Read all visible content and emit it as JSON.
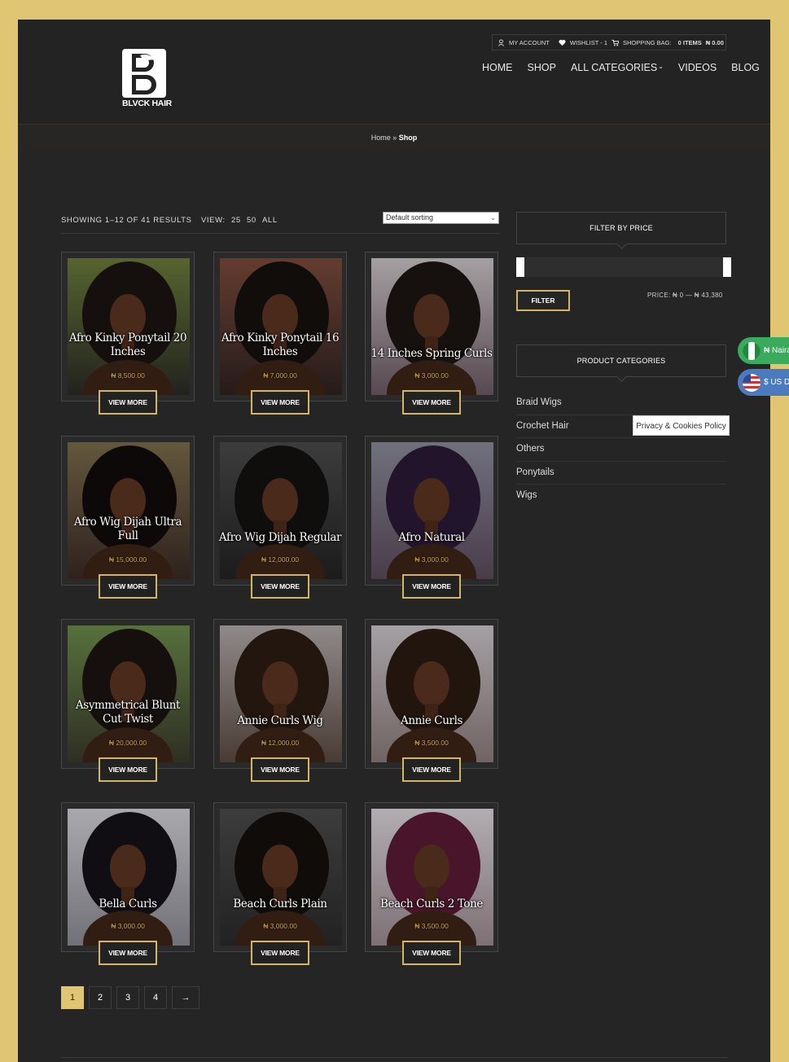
{
  "header": {
    "logo_letter": "B",
    "logo_text": "BLVCK HAIR",
    "topbar": {
      "account": "MY ACCOUNT",
      "wishlist": "WISHLIST - 1",
      "bag_label": "SHOPPING BAG:",
      "bag_items": "0 ITEMS",
      "bag_total": "₦ 0.00"
    },
    "nav": [
      "HOME",
      "SHOP",
      "ALL CATEGORIES",
      "VIDEOS",
      "BLOG"
    ]
  },
  "breadcrumb": {
    "home": "Home",
    "sep": "»",
    "current": "Shop"
  },
  "toolbar": {
    "result_count": "SHOWING 1–12 OF 41 RESULTS",
    "view_label": "VIEW:",
    "view_options": [
      "25",
      "50",
      "ALL"
    ],
    "sort_value": "Default sorting"
  },
  "products": [
    {
      "title": "Afro Kinky Ponytail 20 Inches",
      "price": "₦ 8,500.00",
      "button": "VIEW MORE"
    },
    {
      "title": "Afro Kinky Ponytail 16 Inches",
      "price": "₦ 7,000.00",
      "button": "VIEW MORE"
    },
    {
      "title": "14 Inches Spring Curls",
      "price": "₦ 3,000.00",
      "button": "VIEW MORE"
    },
    {
      "title": "Afro Wig Dijah Ultra Full",
      "price": "₦ 15,000.00",
      "button": "VIEW MORE"
    },
    {
      "title": "Afro Wig Dijah Regular",
      "price": "₦ 12,000.00",
      "button": "VIEW MORE"
    },
    {
      "title": "Afro Natural",
      "price": "₦ 3,000.00",
      "button": "VIEW MORE"
    },
    {
      "title": "Asymmetrical Blunt Cut Twist",
      "price": "₦ 20,000.00",
      "button": "VIEW MORE"
    },
    {
      "title": "Annie Curls Wig",
      "price": "₦ 12,000.00",
      "button": "VIEW MORE"
    },
    {
      "title": "Annie Curls",
      "price": "₦ 3,500.00",
      "button": "VIEW MORE"
    },
    {
      "title": "Bella Curls",
      "price": "₦ 3,000.00",
      "button": "VIEW MORE"
    },
    {
      "title": "Beach Curls Plain",
      "price": "₦ 3,000.00",
      "button": "VIEW MORE"
    },
    {
      "title": "Beach Curls 2 Tone",
      "price": "₦ 3,500.00",
      "button": "VIEW MORE"
    }
  ],
  "pagination": [
    "1",
    "2",
    "3",
    "4",
    "→"
  ],
  "sidebar": {
    "filter_title": "FILTER BY PRICE",
    "filter_button": "FILTER",
    "price_label": "PRICE:",
    "price_min": "₦ 0",
    "price_max": "₦ 43,380",
    "categories_title": "PRODUCT CATEGORIES",
    "categories": [
      "Braid Wigs",
      "Crochet Hair",
      "Others",
      "Ponytails",
      "Wigs"
    ]
  },
  "privacy_label": "Privacy & Cookies Policy",
  "currency": [
    {
      "label": "₦ Naira",
      "color": "#3aaa5c"
    },
    {
      "label": "$ US Dollar",
      "color": "#4a7bbf"
    }
  ],
  "colors": {
    "frame": "#e0c673",
    "page_bg": "#252525",
    "accent": "#d4b660"
  }
}
